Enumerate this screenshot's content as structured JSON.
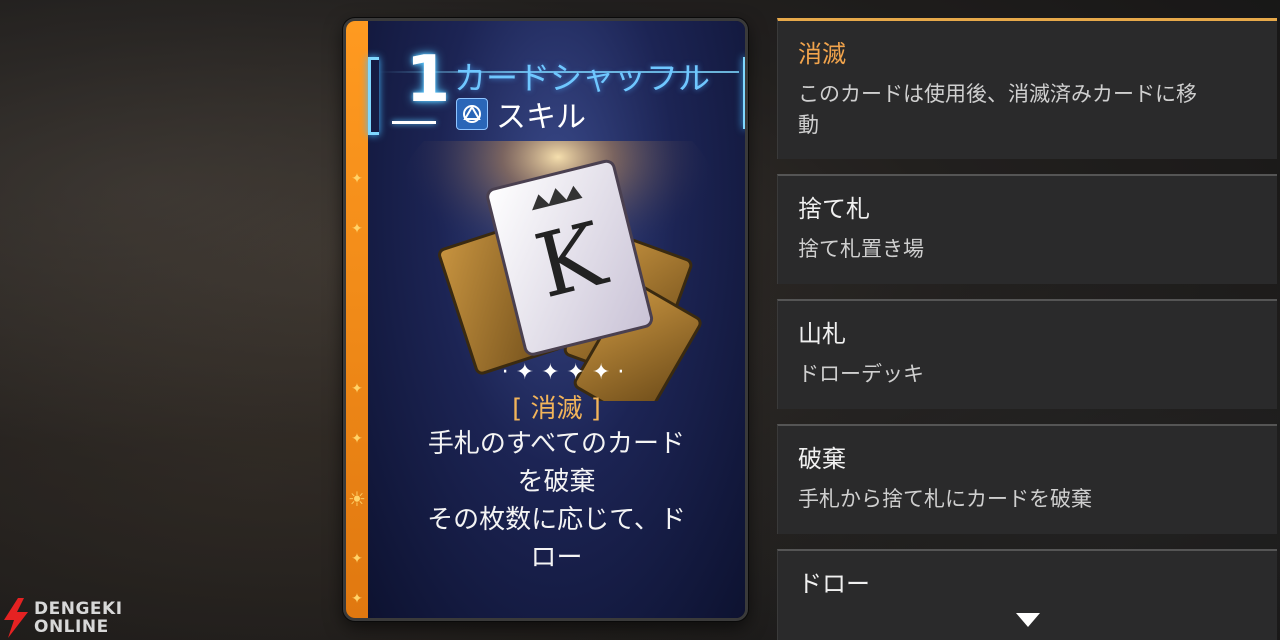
{
  "card": {
    "cost": "1",
    "name": "カードシャッフル",
    "type_label": "スキル",
    "type_icon": "skill-triangle-icon",
    "keyword_tag": "[ 消滅 ]",
    "description_lines": [
      "手札のすべてのカード",
      "を破棄",
      "その枚数に応じて、ド",
      "ロー"
    ],
    "accent_color": "#f08a18",
    "name_color": "#6fc7ff"
  },
  "glossary": {
    "entries": [
      {
        "title": "消滅",
        "desc_lines": [
          "このカードは使用後、消滅済みカードに移",
          "動"
        ],
        "active": true
      },
      {
        "title": "捨て札",
        "desc_lines": [
          "捨て札置き場"
        ],
        "active": false
      },
      {
        "title": "山札",
        "desc_lines": [
          "ドローデッキ"
        ],
        "active": false
      },
      {
        "title": "破棄",
        "desc_lines": [
          "手札から捨て札にカードを破棄"
        ],
        "active": false
      },
      {
        "title": "ドロー",
        "desc_lines": [],
        "active": false
      }
    ],
    "scroll_icon": "triangle-down-icon",
    "highlight_color": "#f2a44c"
  },
  "watermark": {
    "line1": "DENGEKI",
    "line2": "ONLINE"
  }
}
